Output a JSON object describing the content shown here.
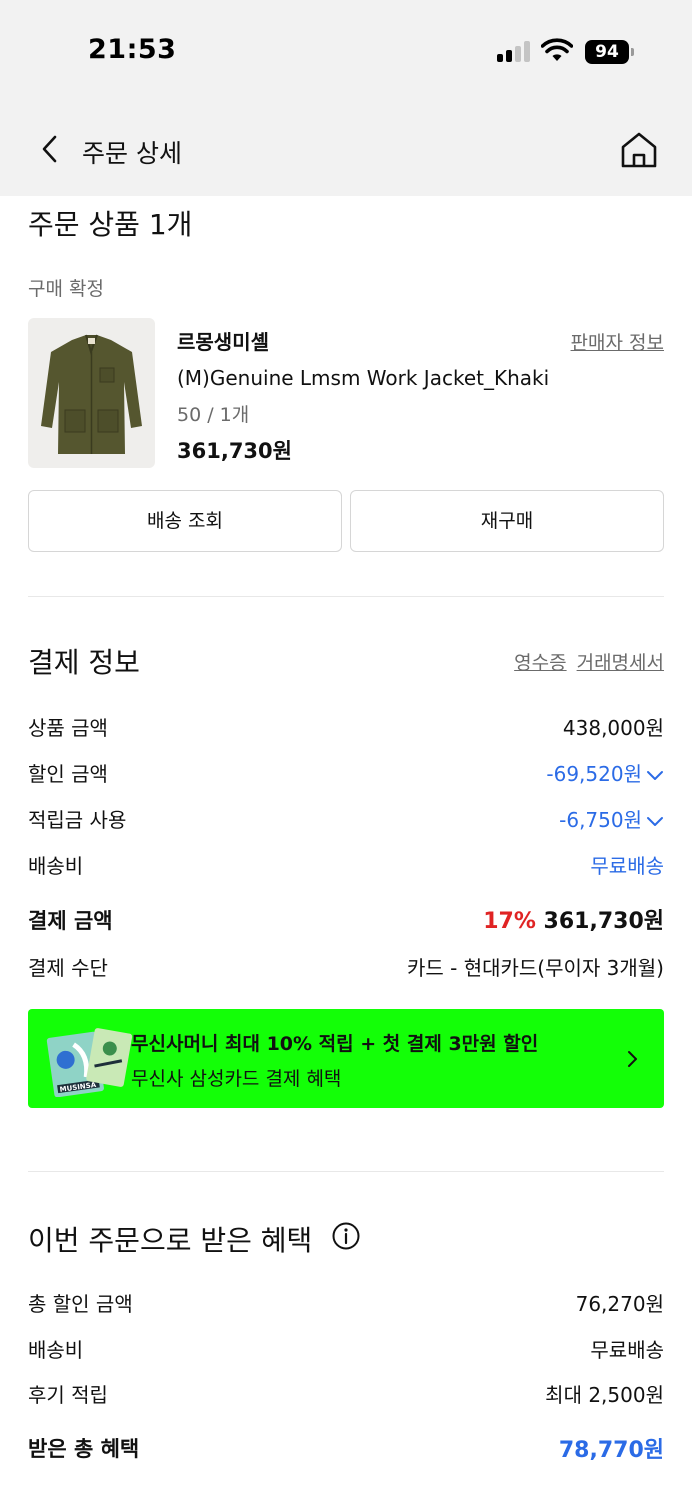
{
  "status": {
    "time": "21:53",
    "battery": "94"
  },
  "nav": {
    "title": "주문 상세"
  },
  "order": {
    "title": "주문 상품 1개",
    "status": "구매 확정",
    "product": {
      "brand": "르몽생미셸",
      "seller_link": "판매자 정보",
      "name": "(M)Genuine Lmsm Work Jacket_Khaki",
      "option": "50 / 1개",
      "price": "361,730원"
    },
    "buttons": {
      "track": "배송 조회",
      "rebuy": "재구매"
    }
  },
  "payment": {
    "title": "결제 정보",
    "receipt_link": "영수증",
    "statement_link": "거래명세서",
    "rows": [
      {
        "label": "상품 금액",
        "value": "438,000원"
      },
      {
        "label": "할인 금액",
        "value": "-69,520원"
      },
      {
        "label": "적립금 사용",
        "value": "-6,750원"
      },
      {
        "label": "배송비",
        "value": "무료배송"
      }
    ],
    "total_label": "결제 금액",
    "total_discount": "17%",
    "total_value": "361,730원",
    "method_label": "결제 수단",
    "method_value": "카드 - 현대카드(무이자 3개월)"
  },
  "promo": {
    "title": "무신사머니 최대 10% 적립 + 첫 결제 3만원 할인",
    "subtitle": "무신사 삼성카드 결제 혜택",
    "card_text": "MUSINSA",
    "bg_color": "#13ff07"
  },
  "benefits": {
    "title": "이번 주문으로 받은 혜택",
    "rows": [
      {
        "label": "총 할인 금액",
        "value": "76,270원"
      },
      {
        "label": "배송비",
        "value": "무료배송"
      },
      {
        "label": "후기 적립",
        "value": "최대 2,500원"
      }
    ],
    "total_label": "받은 총 혜택",
    "total_value": "78,770원"
  },
  "colors": {
    "accent_blue": "#2b6be6",
    "discount_red": "#e02424"
  }
}
